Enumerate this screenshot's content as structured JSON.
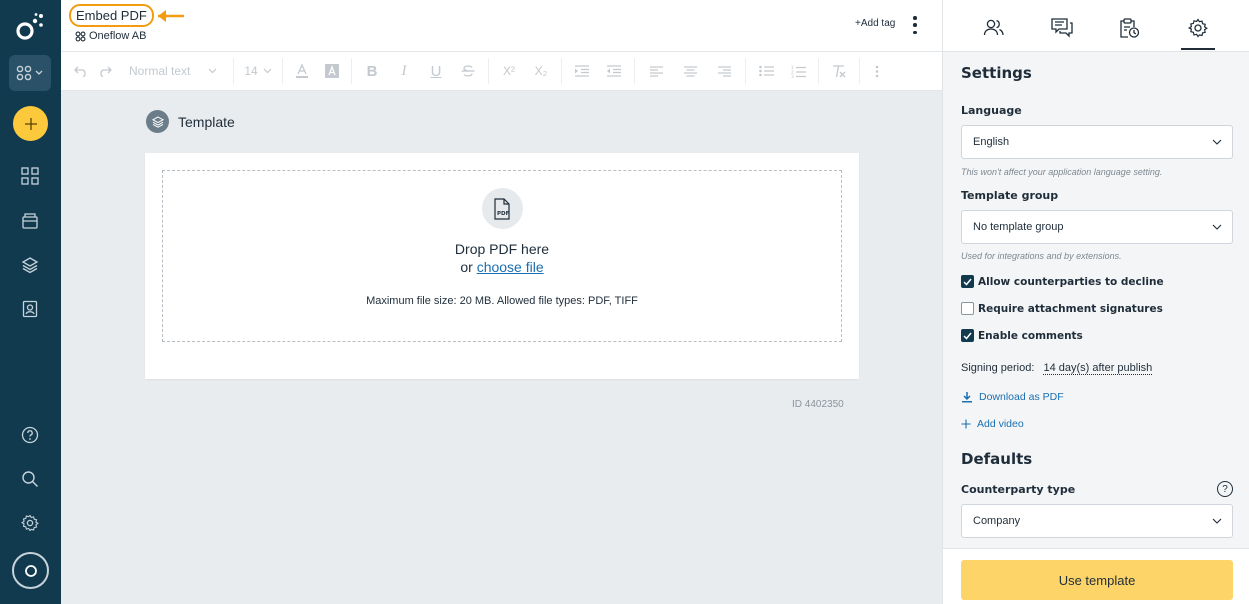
{
  "header": {
    "doc_title": "Embed PDF",
    "company": "Oneflow AB",
    "add_tag": "+Add tag"
  },
  "toolbar": {
    "style_dropdown": "Normal text",
    "size_dropdown": "14",
    "superscript": "X²",
    "subscript": "X₂"
  },
  "canvas": {
    "section_label": "Template",
    "drop_title": "Drop PDF here",
    "drop_or": "or",
    "choose_file": "choose file",
    "limits": "Maximum file size: 20 MB. Allowed file types: PDF, TIFF",
    "doc_id": "ID 4402350"
  },
  "settings": {
    "heading": "Settings",
    "language_label": "Language",
    "language_value": "English",
    "language_hint": "This won't affect your application language setting.",
    "group_label": "Template group",
    "group_value": "No template group",
    "group_hint": "Used for integrations and by extensions.",
    "checks": [
      {
        "label": "Allow counterparties to decline",
        "checked": true
      },
      {
        "label": "Require attachment signatures",
        "checked": false
      },
      {
        "label": "Enable comments",
        "checked": true
      }
    ],
    "signing_label": "Signing period:",
    "signing_value": "14 day(s) after publish",
    "download_pdf": "Download as PDF",
    "add_video": "Add video"
  },
  "defaults": {
    "heading": "Defaults",
    "counterparty_label": "Counterparty type",
    "counterparty_value": "Company",
    "help": "?"
  },
  "footer": {
    "use_template": "Use template"
  },
  "colors": {
    "nav_bg": "#123a4f",
    "accent_yellow": "#fcc93d",
    "button_yellow": "#fdd467",
    "link_blue": "#1a6fb0",
    "highlight_orange": "#f39c12"
  }
}
